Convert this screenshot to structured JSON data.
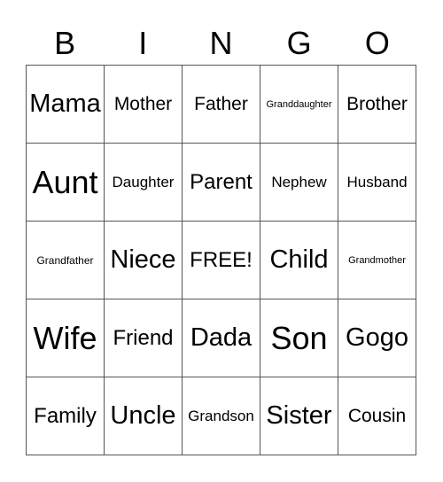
{
  "card": {
    "header": [
      "B",
      "I",
      "N",
      "G",
      "O"
    ],
    "cells": [
      [
        "Mama",
        "Mother",
        "Father",
        "Granddaughter",
        "Brother"
      ],
      [
        "Aunt",
        "Daughter",
        "Parent",
        "Nephew",
        "Husband"
      ],
      [
        "Grandfather",
        "Niece",
        "FREE!",
        "Child",
        "Grandmother"
      ],
      [
        "Wife",
        "Friend",
        "Dada",
        "Son",
        "Gogo"
      ],
      [
        "Family",
        "Uncle",
        "Grandson",
        "Sister",
        "Cousin"
      ]
    ]
  }
}
